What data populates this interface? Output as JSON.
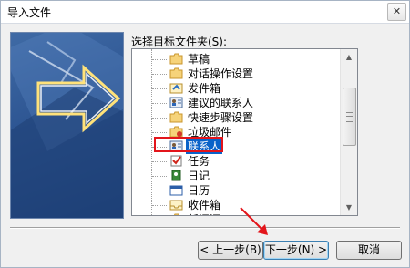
{
  "window": {
    "title": "导入文件",
    "close_icon": "✕"
  },
  "folder_label": "选择目标文件夹(S):",
  "tree": {
    "items": [
      {
        "label": "草稿",
        "icon": "folder-icon"
      },
      {
        "label": "对话操作设置",
        "icon": "folder-icon"
      },
      {
        "label": "发件箱",
        "icon": "outbox-icon"
      },
      {
        "label": "建议的联系人",
        "icon": "contacts-icon"
      },
      {
        "label": "快速步骤设置",
        "icon": "folder-icon"
      },
      {
        "label": "垃圾邮件",
        "icon": "junk-icon"
      },
      {
        "label": "联系人",
        "icon": "contacts-icon",
        "selected": true
      },
      {
        "label": "任务",
        "icon": "tasks-icon"
      },
      {
        "label": "日记",
        "icon": "journal-icon"
      },
      {
        "label": "日历",
        "icon": "calendar-icon"
      },
      {
        "label": "收件箱",
        "icon": "inbox-icon"
      },
      {
        "label": "新闻源",
        "icon": "folder-icon"
      }
    ]
  },
  "buttons": {
    "back": "< 上一步(B)",
    "next": "下一步(N) >",
    "cancel": "取消"
  },
  "colors": {
    "selection": "#0a63c9",
    "highlight_box": "#e3151b",
    "annotation_arrow": "#e3151b"
  }
}
